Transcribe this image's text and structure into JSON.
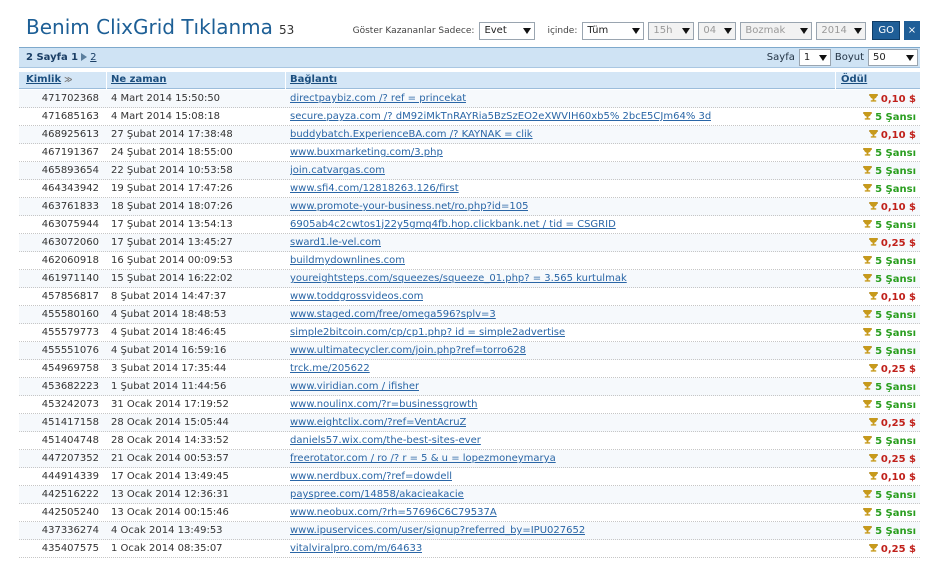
{
  "header": {
    "title": "Benim ClixGrid Tıklanma",
    "count": "53",
    "filter_label": "Göster Kazananlar Sadece:",
    "filter_value": "Evet",
    "in_label": "içinde:",
    "selects": [
      "Tüm",
      "15h",
      "04",
      "Bozmak",
      "2014"
    ],
    "go_label": "GO",
    "close_label": "×"
  },
  "pager": {
    "info": "2 Sayfa 1",
    "page2_link": "2",
    "page_label": "Sayfa",
    "page_value": "1",
    "size_label": "Boyut",
    "size_value": "50"
  },
  "columns": {
    "id": "Kimlik",
    "date": "Ne zaman",
    "link": "Bağlantı",
    "prize": "Ödül"
  },
  "rows": [
    {
      "id": "471702368",
      "date": "4 Mart 2014 15:50:50",
      "link": "directpaybiz.com /? ref = princekat",
      "prize": "0,10 $",
      "type": "red"
    },
    {
      "id": "471685163",
      "date": "4 Mart 2014 15:08:18",
      "link": "secure.payza.com /? dM92iMkTnRAYRia5BzSzEO2eXWVIH60xb5% 2bcE5CJm64% 3d",
      "prize": "5 Şansı",
      "type": "green"
    },
    {
      "id": "468925613",
      "date": "27 Şubat 2014 17:38:48",
      "link": "buddybatch.ExperienceBA.com /? KAYNAK = clik",
      "prize": "0,10 $",
      "type": "red"
    },
    {
      "id": "467191367",
      "date": "24 Şubat 2014 18:55:00",
      "link": "www.buxmarketing.com/3.php",
      "prize": "5 Şansı",
      "type": "green"
    },
    {
      "id": "465893654",
      "date": "22 Şubat 2014 10:53:58",
      "link": "join.catvargas.com",
      "prize": "5 Şansı",
      "type": "green"
    },
    {
      "id": "464343942",
      "date": "19 Şubat 2014 17:47:26",
      "link": "www.sfi4.com/12818263.126/first",
      "prize": "5 Şansı",
      "type": "green"
    },
    {
      "id": "463761833",
      "date": "18 Şubat 2014 18:07:26",
      "link": "www.promote-your-business.net/ro.php?id=105",
      "prize": "0,10 $",
      "type": "red"
    },
    {
      "id": "463075944",
      "date": "17 Şubat 2014 13:54:13",
      "link": "6905ab4c2cwtos1j22y5gmq4fb.hop.clickbank.net / tid = CSGRID",
      "prize": "5 Şansı",
      "type": "green"
    },
    {
      "id": "463072060",
      "date": "17 Şubat 2014 13:45:27",
      "link": "sward1.le-vel.com",
      "prize": "0,25 $",
      "type": "red"
    },
    {
      "id": "462060918",
      "date": "16 Şubat 2014 00:09:53",
      "link": "buildmydownlines.com",
      "prize": "5 Şansı",
      "type": "green"
    },
    {
      "id": "461971140",
      "date": "15 Şubat 2014 16:22:02",
      "link": "youreightsteps.com/squeezes/squeeze_01.php? = 3.565 kurtulmak",
      "prize": "5 Şansı",
      "type": "green"
    },
    {
      "id": "457856817",
      "date": "8 Şubat 2014 14:47:37",
      "link": "www.toddgrossvideos.com",
      "prize": "0,10 $",
      "type": "red"
    },
    {
      "id": "455580160",
      "date": "4 Şubat 2014 18:48:53",
      "link": "www.staged.com/free/omega596?splv=3",
      "prize": "5 Şansı",
      "type": "green"
    },
    {
      "id": "455579773",
      "date": "4 Şubat 2014 18:46:45",
      "link": "simple2bitcoin.com/cp/cp1.php? id = simple2advertise",
      "prize": "5 Şansı",
      "type": "green"
    },
    {
      "id": "455551076",
      "date": "4 Şubat 2014 16:59:16",
      "link": "www.ultimatecycler.com/join.php?ref=torro628",
      "prize": "5 Şansı",
      "type": "green"
    },
    {
      "id": "454969758",
      "date": "3 Şubat 2014 17:35:44",
      "link": "trck.me/205622",
      "prize": "0,25 $",
      "type": "red"
    },
    {
      "id": "453682223",
      "date": "1 Şubat 2014 11:44:56",
      "link": "www.viridian.com / ifisher",
      "prize": "5 Şansı",
      "type": "green"
    },
    {
      "id": "453242073",
      "date": "31 Ocak 2014 17:19:52",
      "link": "www.noulinx.com/?r=businessgrowth",
      "prize": "5 Şansı",
      "type": "green"
    },
    {
      "id": "451417158",
      "date": "28 Ocak 2014 15:05:44",
      "link": "www.eightclix.com/?ref=VentAcruZ",
      "prize": "0,25 $",
      "type": "red"
    },
    {
      "id": "451404748",
      "date": "28 Ocak 2014 14:33:52",
      "link": "daniels57.wix.com/the-best-sites-ever",
      "prize": "5 Şansı",
      "type": "green"
    },
    {
      "id": "447207352",
      "date": "21 Ocak 2014 00:53:57",
      "link": "freerotator.com / ro /? r = 5 & u = lopezmoneymarya",
      "prize": "0,25 $",
      "type": "red"
    },
    {
      "id": "444914339",
      "date": "17 Ocak 2014 13:49:45",
      "link": "www.nerdbux.com/?ref=dowdell",
      "prize": "0,10 $",
      "type": "red"
    },
    {
      "id": "442516222",
      "date": "13 Ocak 2014 12:36:31",
      "link": "payspree.com/14858/akacieakacie",
      "prize": "5 Şansı",
      "type": "green"
    },
    {
      "id": "442505240",
      "date": "13 Ocak 2014 00:15:46",
      "link": "www.neobux.com/?rh=57696C6C79537A",
      "prize": "5 Şansı",
      "type": "green"
    },
    {
      "id": "437336274",
      "date": "4 Ocak 2014 13:49:53",
      "link": "www.ipuservices.com/user/signup?referred_by=IPU027652",
      "prize": "5 Şansı",
      "type": "green"
    },
    {
      "id": "435407575",
      "date": "1 Ocak 2014 08:35:07",
      "link": "vitalviralpro.com/m/64633",
      "prize": "0,25 $",
      "type": "red"
    }
  ],
  "colors": {
    "title": "#1d5f96",
    "money": "#c0201a",
    "chance": "#2a9e1f",
    "link": "#2a66a6",
    "header_bg": "#d4e6f6"
  },
  "icons": {
    "prize": "trophy-icon",
    "sort": "sort-down-icon"
  }
}
